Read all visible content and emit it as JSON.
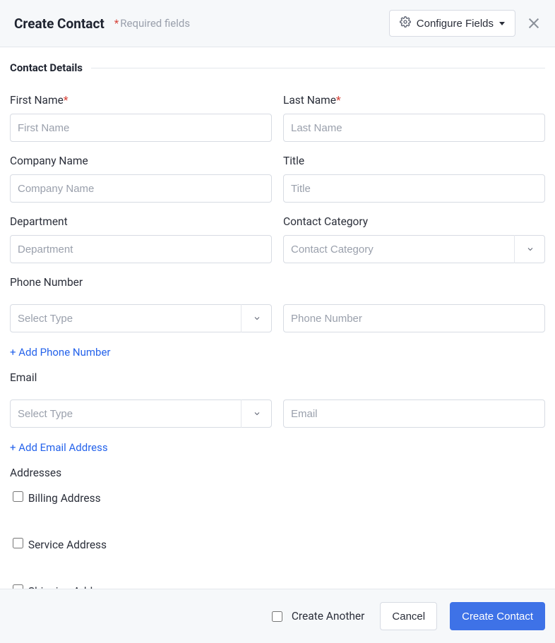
{
  "header": {
    "title": "Create Contact",
    "required_note": "Required fields",
    "configure_label": "Configure Fields"
  },
  "section": {
    "title": "Contact Details"
  },
  "fields": {
    "first_name": {
      "label": "First Name",
      "placeholder": "First Name",
      "required": true
    },
    "last_name": {
      "label": "Last Name",
      "placeholder": "Last Name",
      "required": true
    },
    "company": {
      "label": "Company Name",
      "placeholder": "Company Name"
    },
    "title": {
      "label": "Title",
      "placeholder": "Title"
    },
    "department": {
      "label": "Department",
      "placeholder": "Department"
    },
    "category": {
      "label": "Contact Category",
      "placeholder": "Contact Category"
    },
    "phone": {
      "label": "Phone Number",
      "type_placeholder": "Select Type",
      "value_placeholder": "Phone Number",
      "add_label": "+ Add Phone Number"
    },
    "email": {
      "label": "Email",
      "type_placeholder": "Select Type",
      "value_placeholder": "Email",
      "add_label": "+ Add Email Address"
    },
    "addresses": {
      "label": "Addresses",
      "options": [
        "Billing Address",
        "Service Address",
        "Shipping Address"
      ]
    }
  },
  "footer": {
    "create_another": "Create Another",
    "cancel": "Cancel",
    "submit": "Create Contact"
  }
}
